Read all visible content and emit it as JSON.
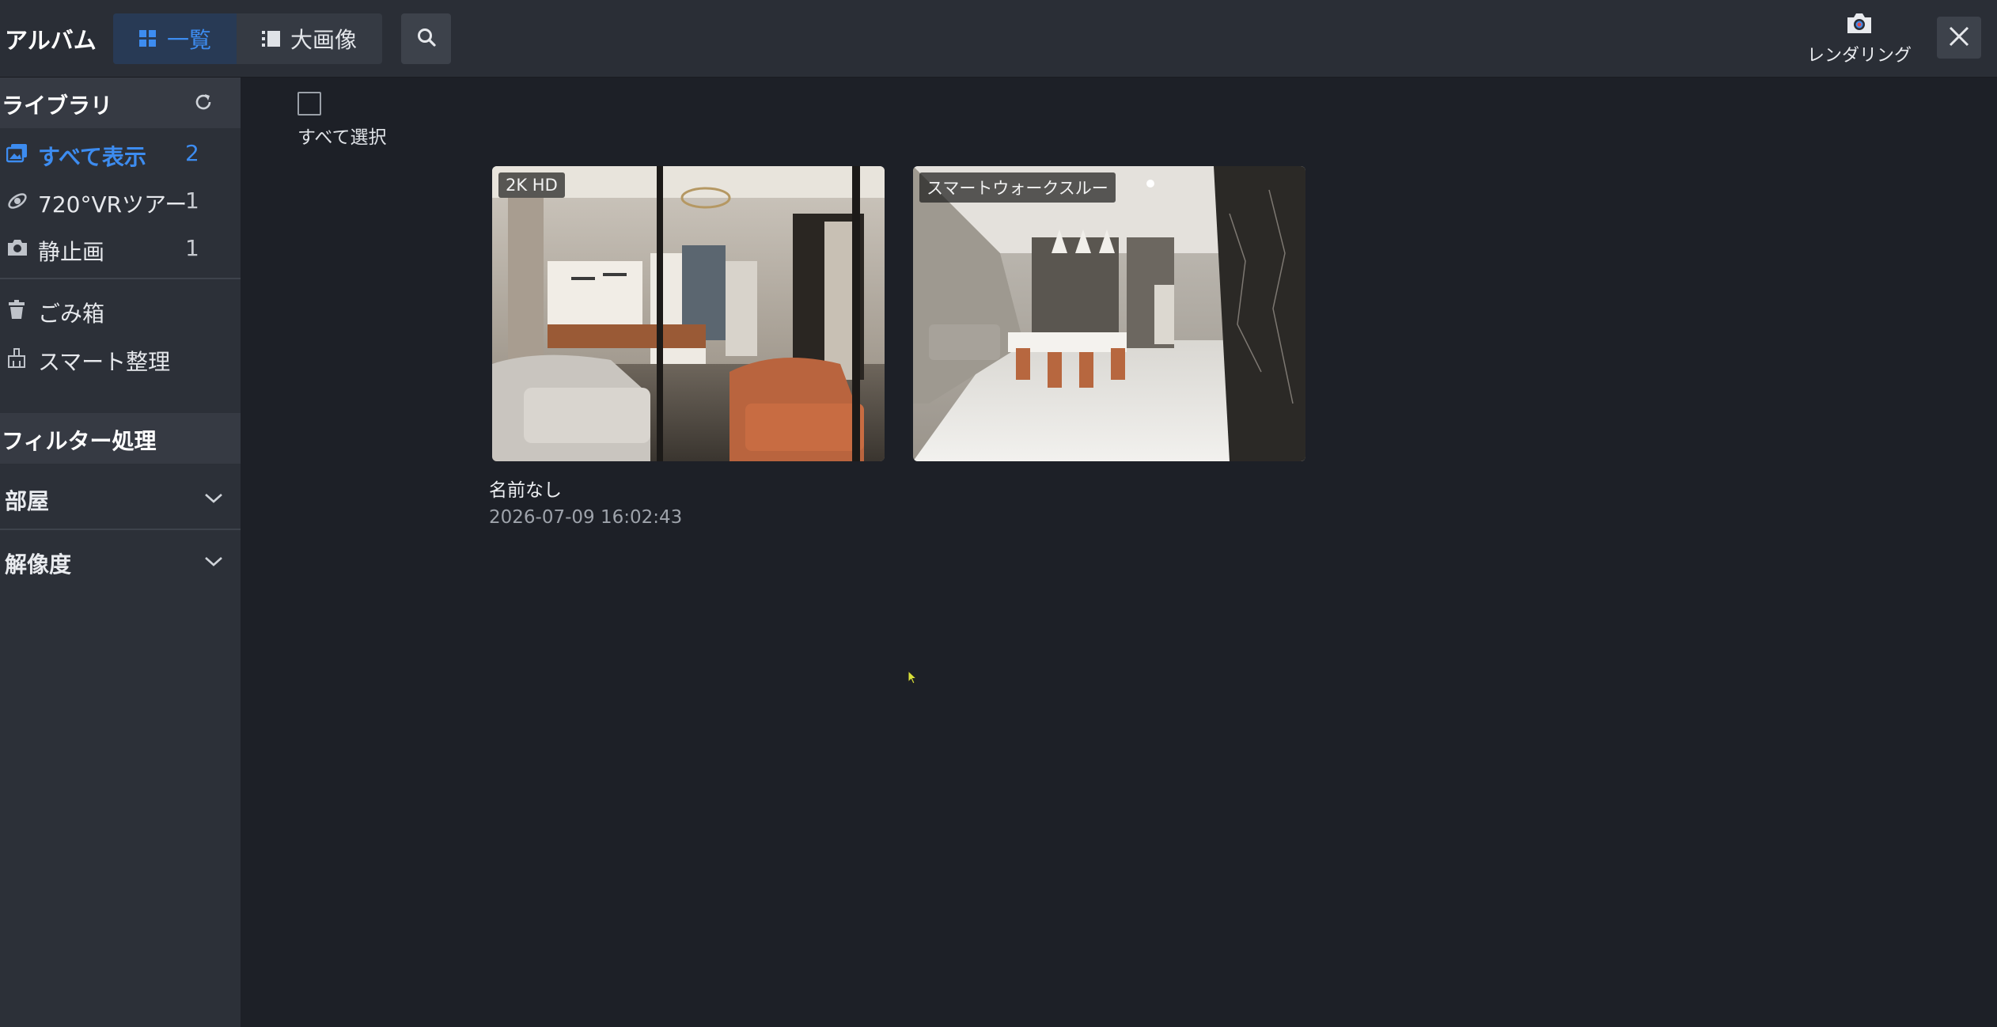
{
  "header": {
    "title": "アルバム",
    "tabs": [
      {
        "label": "一覧",
        "icon": "grid-icon",
        "active": true
      },
      {
        "label": "大画像",
        "icon": "large-image-icon",
        "active": false
      }
    ],
    "render_label": "レンダリング",
    "accent_color": "#3d8cf0"
  },
  "sidebar": {
    "library_title": "ライブラリ",
    "items": [
      {
        "label": "すべて表示",
        "count": "2",
        "icon": "images-icon",
        "active": true
      },
      {
        "label": "720°VRツアー",
        "count": "1",
        "icon": "vr-tour-icon"
      },
      {
        "label": "静止画",
        "count": "1",
        "icon": "camera-icon"
      },
      {
        "label": "ごみ箱",
        "icon": "trash-icon"
      },
      {
        "label": "スマート整理",
        "icon": "broom-icon"
      }
    ],
    "filter_title": "フィルター処理",
    "filters": [
      {
        "label": "部屋"
      },
      {
        "label": "解像度"
      }
    ]
  },
  "main": {
    "select_all_label": "すべて選択",
    "cards": [
      {
        "badge": "2K HD",
        "name": "名前なし",
        "date": "2026-07-09 16:02:43"
      },
      {
        "badge": "スマートウォークスルー"
      }
    ]
  }
}
